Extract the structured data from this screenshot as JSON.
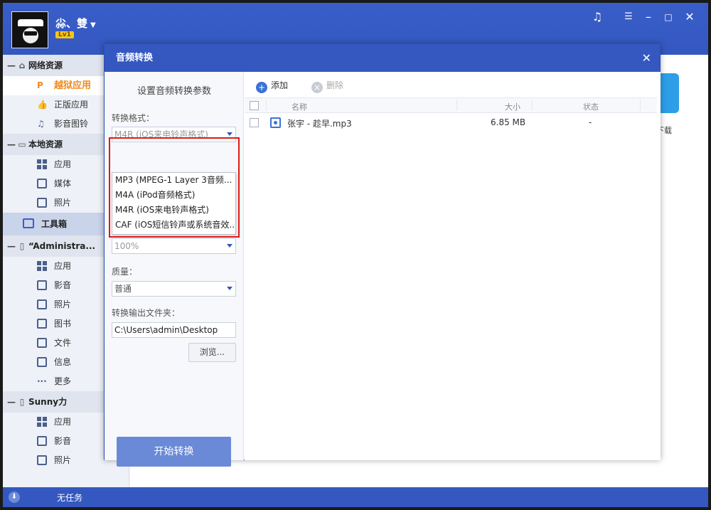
{
  "user": {
    "name": "尛、雙",
    "level": "Lv1"
  },
  "window_controls": [
    "music-icon",
    "menu-icon",
    "minimize-icon",
    "maximize-icon",
    "close-icon"
  ],
  "sidebar": {
    "sections": [
      {
        "title": "网络资源",
        "icon": "home-icon",
        "items": [
          {
            "label": "越狱应用",
            "icon": "p-icon",
            "active": true
          },
          {
            "label": "正版应用",
            "icon": "thumb-icon"
          },
          {
            "label": "影音图铃",
            "icon": "music-note-icon"
          }
        ]
      },
      {
        "title": "本地资源",
        "icon": "monitor-icon",
        "items": [
          {
            "label": "应用",
            "icon": "grid-icon"
          },
          {
            "label": "媒体",
            "icon": "video-icon"
          },
          {
            "label": "照片",
            "icon": "photo-icon"
          }
        ]
      }
    ],
    "tools_label": "工具箱",
    "devices": [
      {
        "title": "“Administra...",
        "items": [
          {
            "label": "应用",
            "icon": "grid-icon"
          },
          {
            "label": "影音",
            "icon": "video-icon"
          },
          {
            "label": "照片",
            "icon": "photo-icon"
          },
          {
            "label": "图书",
            "icon": "book-icon"
          },
          {
            "label": "文件",
            "icon": "file-icon"
          },
          {
            "label": "信息",
            "icon": "message-icon"
          },
          {
            "label": "更多",
            "icon": "more-icon"
          }
        ]
      },
      {
        "title": "Sunny力",
        "items": [
          {
            "label": "应用",
            "icon": "grid-icon"
          },
          {
            "label": "影音",
            "icon": "video-icon"
          },
          {
            "label": "照片",
            "icon": "photo-icon"
          }
        ]
      }
    ]
  },
  "status": {
    "text": "无任务"
  },
  "background": {
    "tile_label": "下载"
  },
  "dialog": {
    "title": "音频转换",
    "left": {
      "heading": "设置音频转换参数",
      "format_label": "转换格式：",
      "format_value": "M4R (iOS来电铃声格式)",
      "format_options": [
        "MP3 (MPEG-1 Layer 3音频...",
        "M4A (iPod音频格式)",
        "M4R (iOS来电铃声格式)",
        "CAF (iOS短信铃声或系统音效..."
      ],
      "volume_value": "100%",
      "quality_label": "质量：",
      "quality_value": "普通",
      "output_label": "转换输出文件夹：",
      "output_path": "C:\\Users\\admin\\Desktop",
      "browse_label": "浏览...",
      "start_label": "开始转换"
    },
    "right": {
      "add_label": "添加",
      "delete_label": "删除",
      "columns": {
        "name": "名称",
        "size": "大小",
        "status": "状态"
      },
      "rows": [
        {
          "name": "张宇 - 趁早.mp3",
          "size": "6.85 MB",
          "status": "-"
        }
      ]
    }
  }
}
